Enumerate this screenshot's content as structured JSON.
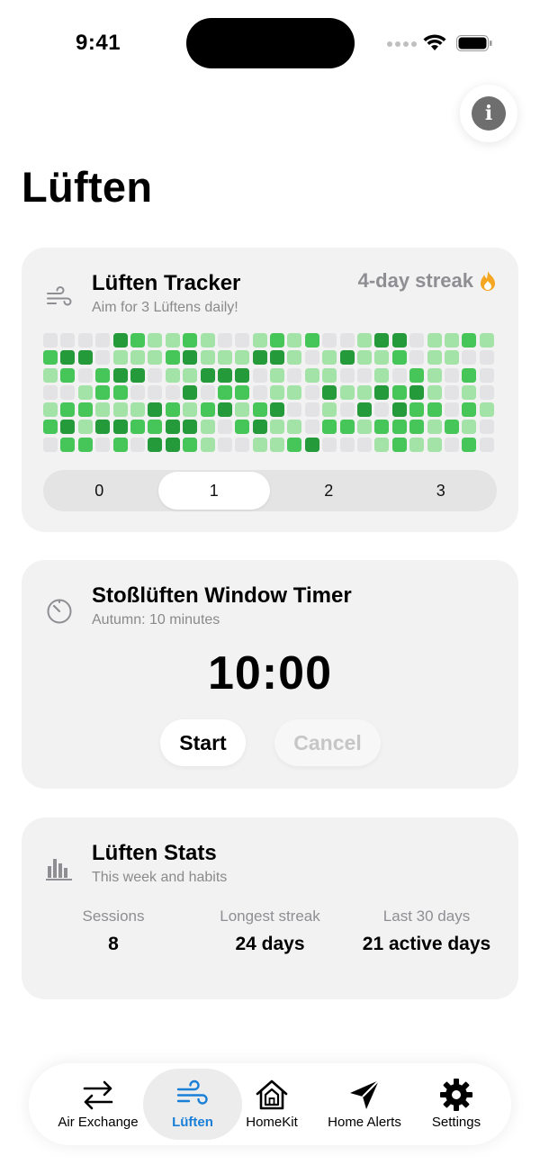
{
  "status_bar": {
    "time": "9:41"
  },
  "page": {
    "title": "Lüften"
  },
  "tracker": {
    "title": "Lüften Tracker",
    "subtitle": "Aim for 3 Lüftens daily!",
    "streak": "4-day streak",
    "grid_levels": [
      [
        0,
        0,
        0,
        0,
        3,
        2,
        1,
        1,
        2,
        1,
        0,
        0,
        1,
        2,
        1,
        2,
        0,
        0,
        1,
        3,
        3,
        0,
        1,
        1,
        2,
        1
      ],
      [
        2,
        3,
        3,
        0,
        1,
        1,
        1,
        2,
        3,
        1,
        1,
        1,
        3,
        3,
        1,
        0,
        1,
        3,
        1,
        1,
        2,
        0,
        1,
        1,
        0,
        0
      ],
      [
        1,
        2,
        0,
        2,
        3,
        3,
        0,
        1,
        1,
        3,
        3,
        3,
        0,
        1,
        0,
        1,
        1,
        0,
        0,
        1,
        0,
        2,
        1,
        0,
        2,
        0
      ],
      [
        0,
        0,
        1,
        2,
        2,
        0,
        0,
        0,
        3,
        0,
        2,
        2,
        0,
        1,
        1,
        0,
        3,
        1,
        1,
        3,
        2,
        3,
        1,
        0,
        1,
        0
      ],
      [
        1,
        2,
        2,
        1,
        1,
        1,
        3,
        2,
        1,
        2,
        3,
        1,
        2,
        3,
        0,
        0,
        1,
        0,
        3,
        0,
        3,
        2,
        2,
        0,
        2,
        1
      ],
      [
        2,
        3,
        1,
        3,
        3,
        2,
        2,
        3,
        3,
        1,
        0,
        2,
        3,
        1,
        1,
        0,
        2,
        2,
        1,
        2,
        2,
        2,
        1,
        2,
        1,
        0
      ],
      [
        0,
        2,
        2,
        0,
        2,
        0,
        3,
        3,
        2,
        1,
        0,
        0,
        1,
        1,
        2,
        3,
        0,
        0,
        0,
        1,
        2,
        1,
        1,
        0,
        2,
        0
      ]
    ],
    "segments": [
      "0",
      "1",
      "2",
      "3"
    ],
    "selected_segment": "1"
  },
  "timer": {
    "title": "Stoßlüften Window Timer",
    "subtitle": "Autumn: 10 minutes",
    "display": "10:00",
    "start_label": "Start",
    "cancel_label": "Cancel"
  },
  "stats": {
    "title": "Lüften Stats",
    "subtitle": "This week and habits",
    "items": [
      {
        "label": "Sessions",
        "value": "8"
      },
      {
        "label": "Longest streak",
        "value": "24 days"
      },
      {
        "label": "Last 30 days",
        "value": "21 active days"
      }
    ]
  },
  "tabs": [
    {
      "label": "Air Exchange",
      "icon": "arrows-exchange-icon"
    },
    {
      "label": "Lüften",
      "icon": "wind-icon",
      "active": true
    },
    {
      "label": "HomeKit",
      "icon": "house-icon"
    },
    {
      "label": "Home Alerts",
      "icon": "paperplane-icon"
    },
    {
      "label": "Settings",
      "icon": "gear-icon"
    }
  ],
  "colors": {
    "accent": "#1a7fd6",
    "streak_flame": "#f5a623",
    "level_1": "#a3e3a8",
    "level_2": "#46c558",
    "level_3": "#259a3a",
    "empty": "#e3e3e6"
  }
}
